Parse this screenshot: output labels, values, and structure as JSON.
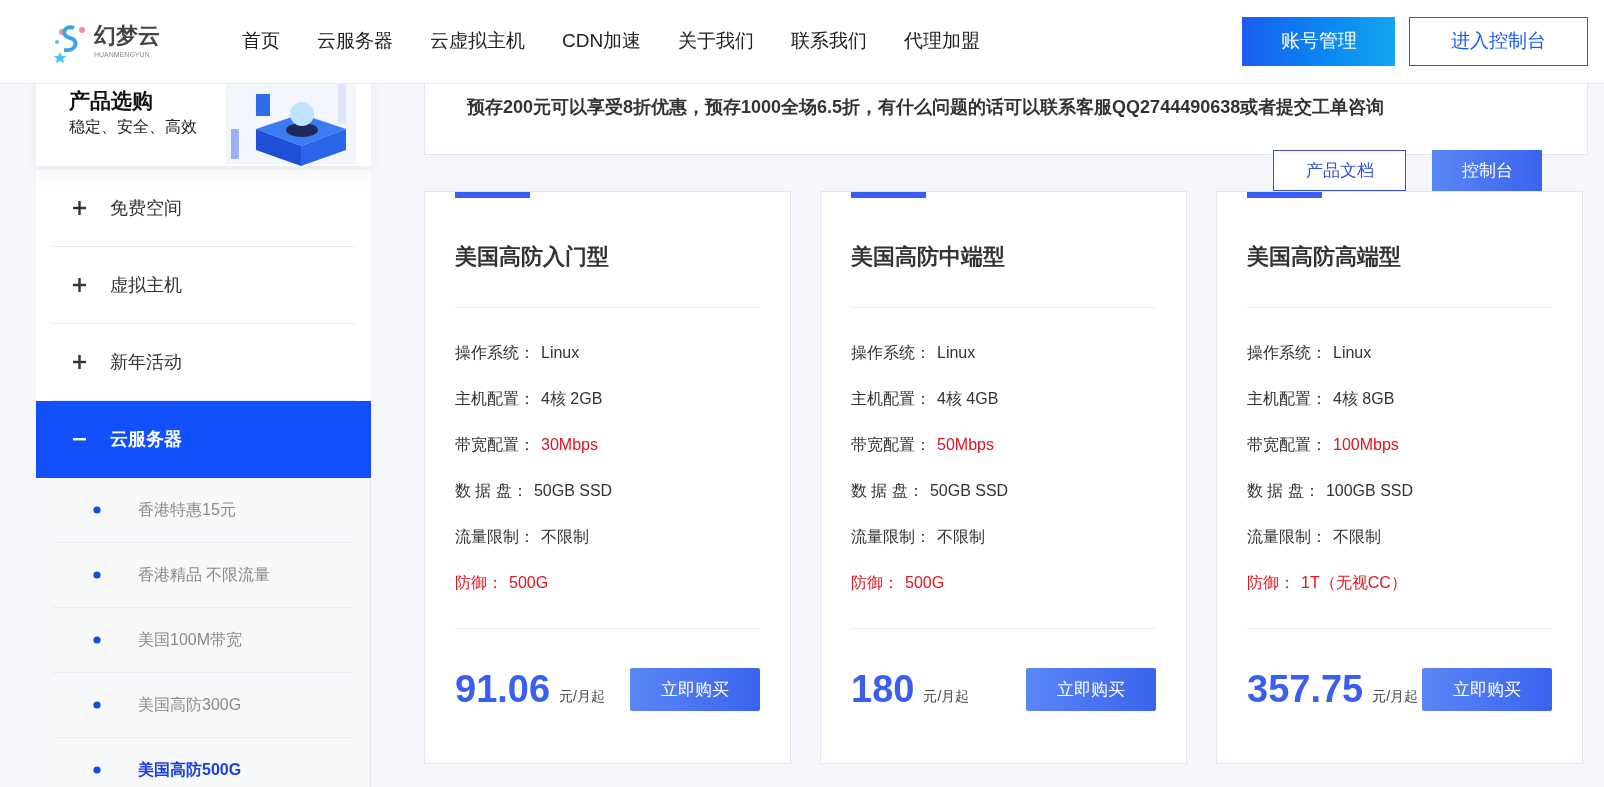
{
  "header": {
    "logo": {
      "name": "幻梦云",
      "subtitle": "HUANMENGYUN"
    },
    "nav": [
      {
        "label": "首页"
      },
      {
        "label": "云服务器"
      },
      {
        "label": "云虚拟主机"
      },
      {
        "label": "CDN加速"
      },
      {
        "label": "关于我们"
      },
      {
        "label": "联系我们"
      },
      {
        "label": "代理加盟"
      }
    ],
    "buttons": [
      {
        "label": "账号管理",
        "kind": "primary"
      },
      {
        "label": "进入控制台",
        "kind": "outline"
      }
    ]
  },
  "sidebar": {
    "title": "产品选购",
    "subtitle": "稳定、安全、高效",
    "items": [
      {
        "label": "免费空间",
        "expanded": false
      },
      {
        "label": "虚拟主机",
        "expanded": false
      },
      {
        "label": "新年活动",
        "expanded": false
      },
      {
        "label": "云服务器",
        "expanded": true,
        "children": [
          {
            "label": "香港特惠15元",
            "selected": false
          },
          {
            "label": "香港精品 不限流量",
            "selected": false
          },
          {
            "label": "美国100M带宽",
            "selected": false
          },
          {
            "label": "美国高防300G",
            "selected": false
          },
          {
            "label": "美国高防500G",
            "selected": true
          }
        ]
      }
    ]
  },
  "notice": "预存200元可以享受8折优惠，预存1000全场6.5折，有什么问题的话可以联系客服QQ2744490638或者提交工单咨询",
  "actions": [
    {
      "label": "产品文档",
      "kind": "outline"
    },
    {
      "label": "控制台",
      "kind": "primary"
    }
  ],
  "products": [
    {
      "name": "美国高防入门型",
      "specs": [
        {
          "label": "操作系统：",
          "value": "Linux",
          "kind": "plain"
        },
        {
          "label": "主机配置：",
          "value": "4核 2GB",
          "kind": "plain"
        },
        {
          "label": "带宽配置：",
          "value": "30Mbps",
          "kind": "accent"
        },
        {
          "label": "数 据 盘：",
          "value": "50GB SSD",
          "kind": "plain"
        },
        {
          "label": "流量限制：",
          "value": "不限制",
          "kind": "plain"
        },
        {
          "label": "防御：",
          "value": "500G",
          "kind": "warning"
        }
      ],
      "price": "91.06",
      "unit": "元/月起",
      "button": "立即购买"
    },
    {
      "name": "美国高防中端型",
      "specs": [
        {
          "label": "操作系统：",
          "value": "Linux",
          "kind": "plain"
        },
        {
          "label": "主机配置：",
          "value": "4核 4GB",
          "kind": "plain"
        },
        {
          "label": "带宽配置：",
          "value": "50Mbps",
          "kind": "accent"
        },
        {
          "label": "数 据 盘：",
          "value": "50GB SSD",
          "kind": "plain"
        },
        {
          "label": "流量限制：",
          "value": "不限制",
          "kind": "plain"
        },
        {
          "label": "防御：",
          "value": "500G",
          "kind": "warning"
        }
      ],
      "price": "180",
      "unit": "元/月起",
      "button": "立即购买"
    },
    {
      "name": "美国高防高端型",
      "specs": [
        {
          "label": "操作系统：",
          "value": "Linux",
          "kind": "plain"
        },
        {
          "label": "主机配置：",
          "value": "4核 8GB",
          "kind": "plain"
        },
        {
          "label": "带宽配置：",
          "value": "100Mbps",
          "kind": "accent"
        },
        {
          "label": "数 据 盘：",
          "value": "100GB SSD",
          "kind": "plain"
        },
        {
          "label": "流量限制：",
          "value": "不限制",
          "kind": "plain"
        },
        {
          "label": "防御：",
          "value": "1T（无视CC）",
          "kind": "warning"
        }
      ],
      "price": "357.75",
      "unit": "元/月起",
      "button": "立即购买"
    }
  ]
}
